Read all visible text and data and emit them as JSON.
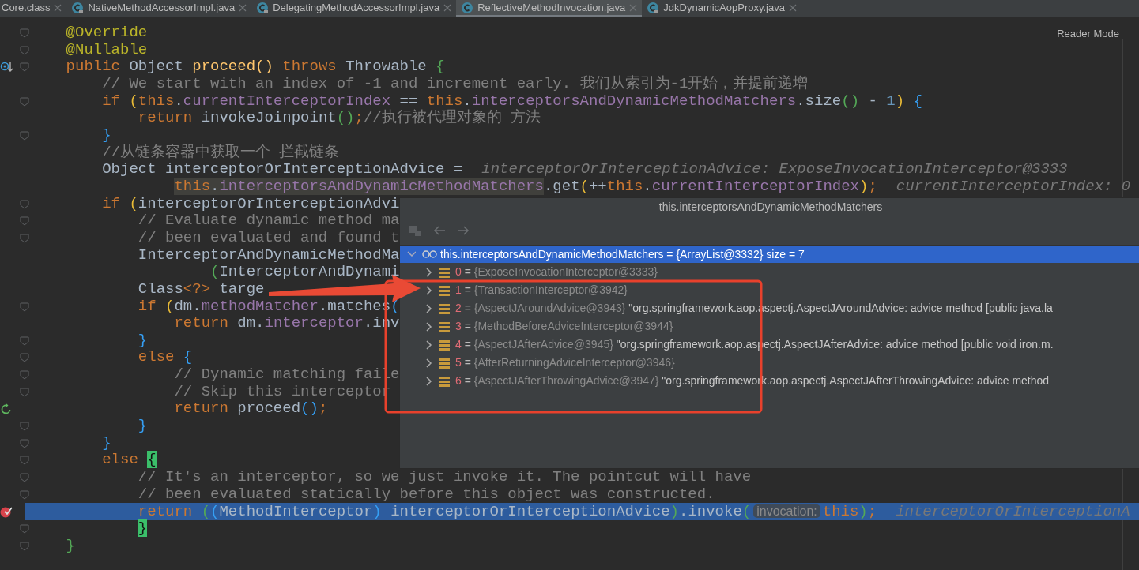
{
  "tabs": [
    {
      "label": "Core.class",
      "kind": "plain",
      "selected": false
    },
    {
      "label": "NativeMethodAccessorImpl.java",
      "kind": "class",
      "locked": true,
      "selected": false
    },
    {
      "label": "DelegatingMethodAccessorImpl.java",
      "kind": "class",
      "locked": true,
      "selected": false
    },
    {
      "label": "ReflectiveMethodInvocation.java",
      "kind": "class",
      "locked": false,
      "selected": true
    },
    {
      "label": "JdkDynamicAopProxy.java",
      "kind": "class",
      "locked": true,
      "selected": false
    }
  ],
  "reader_mode": "Reader Mode",
  "code_lines": [
    {
      "fold": true,
      "kind": "code",
      "tokens": [
        {
          "kind": "ann",
          "t": "    @Override"
        }
      ]
    },
    {
      "fold": true,
      "kind": "code",
      "tokens": [
        {
          "kind": "ann",
          "t": "    @Nullable"
        }
      ]
    },
    {
      "fold": true,
      "kind": "override",
      "tokens": [
        {
          "kind": "kw",
          "t": "    public"
        },
        {
          "kind": "p",
          "t": " Object "
        },
        {
          "kind": "fn",
          "t": "proceed()"
        },
        {
          "kind": "kw",
          "t": " throws"
        },
        {
          "kind": "p",
          "t": " Throwable "
        },
        {
          "kind": "b2",
          "t": "{"
        }
      ]
    },
    {
      "fold": false,
      "kind": "code",
      "tokens": [
        {
          "kind": "cm",
          "t": "        // We start with an index of -1 and increment early. 我们从索引为-1开始，并提前递增"
        }
      ]
    },
    {
      "fold": true,
      "kind": "code",
      "tokens": [
        {
          "kind": "kw",
          "t": "        if "
        },
        {
          "kind": "b1",
          "t": "("
        },
        {
          "kind": "kw",
          "t": "this"
        },
        {
          "kind": "p",
          "t": "."
        },
        {
          "kind": "fld",
          "t": "currentInterceptorIndex"
        },
        {
          "kind": "p",
          "t": " == "
        },
        {
          "kind": "kw",
          "t": "this"
        },
        {
          "kind": "p",
          "t": "."
        },
        {
          "kind": "fld",
          "t": "interceptorsAndDynamicMethodMatchers"
        },
        {
          "kind": "p",
          "t": ".size"
        },
        {
          "kind": "b2",
          "t": "()"
        },
        {
          "kind": "p",
          "t": " - "
        },
        {
          "kind": "num",
          "t": "1"
        },
        {
          "kind": "b1",
          "t": ")"
        },
        {
          "kind": "b3",
          "t": " {"
        }
      ]
    },
    {
      "fold": false,
      "kind": "code",
      "tokens": [
        {
          "kind": "kw",
          "t": "            return "
        },
        {
          "kind": "p",
          "t": "invokeJoinpoint"
        },
        {
          "kind": "b2",
          "t": "()"
        },
        {
          "kind": "kw",
          "t": ";"
        },
        {
          "kind": "cm",
          "t": "//执行被代理对象的 方法"
        }
      ]
    },
    {
      "fold": true,
      "kind": "code",
      "tokens": [
        {
          "kind": "b3",
          "t": "        }"
        }
      ]
    },
    {
      "fold": false,
      "kind": "code",
      "tokens": [
        {
          "kind": "cm",
          "t": "        //从链条容器中获取一个 拦截链条"
        }
      ]
    },
    {
      "fold": false,
      "kind": "code",
      "tokens": [
        {
          "kind": "p",
          "t": "        Object interceptorOrInterceptionAdvice ="
        },
        {
          "kind": "hint",
          "t": "interceptorOrInterceptionAdvice: ExposeInvocationInterceptor@3333"
        }
      ]
    },
    {
      "fold": false,
      "kind": "code",
      "tokens": [
        {
          "kind": "kw",
          "t": "                this",
          "hl": true
        },
        {
          "kind": "p",
          "t": ".",
          "hl": true
        },
        {
          "kind": "fld",
          "t": "interceptorsAndDynamicMethodMatchers",
          "hl": true
        },
        {
          "kind": "p",
          "t": ".get"
        },
        {
          "kind": "b1",
          "t": "("
        },
        {
          "kind": "p",
          "t": "++"
        },
        {
          "kind": "kw",
          "t": "this"
        },
        {
          "kind": "p",
          "t": "."
        },
        {
          "kind": "fld",
          "t": "currentInterceptorIndex"
        },
        {
          "kind": "b1",
          "t": ")"
        },
        {
          "kind": "kw",
          "t": ";"
        },
        {
          "kind": "hint",
          "t": "currentInterceptorIndex: 0"
        }
      ]
    },
    {
      "fold": true,
      "kind": "code",
      "tokens": [
        {
          "kind": "kw",
          "t": "        if "
        },
        {
          "kind": "b1",
          "t": "("
        },
        {
          "kind": "p",
          "t": "interceptorOrInterceptionAdvi"
        }
      ]
    },
    {
      "fold": true,
      "kind": "code",
      "tokens": [
        {
          "kind": "cm",
          "t": "            // Evaluate dynamic method ma"
        }
      ]
    },
    {
      "fold": true,
      "kind": "code",
      "tokens": [
        {
          "kind": "cm",
          "t": "            // been evaluated and found t"
        }
      ]
    },
    {
      "fold": false,
      "kind": "code",
      "tokens": [
        {
          "kind": "p",
          "t": "            InterceptorAndDynamicMethodMa"
        }
      ]
    },
    {
      "fold": false,
      "kind": "code",
      "tokens": [
        {
          "kind": "b2",
          "t": "                    ("
        },
        {
          "kind": "p",
          "t": "InterceptorAndDynami"
        }
      ]
    },
    {
      "fold": false,
      "kind": "code",
      "tokens": [
        {
          "kind": "p",
          "t": "            Class"
        },
        {
          "kind": "kw",
          "t": "<?>"
        },
        {
          "kind": "p",
          "t": " targe"
        }
      ]
    },
    {
      "fold": true,
      "kind": "code",
      "tokens": [
        {
          "kind": "kw",
          "t": "            if "
        },
        {
          "kind": "b1",
          "t": "("
        },
        {
          "kind": "p",
          "t": "dm."
        },
        {
          "kind": "fld",
          "t": "methodMatcher"
        },
        {
          "kind": "p",
          "t": ".matches"
        },
        {
          "kind": "b3",
          "t": "("
        }
      ]
    },
    {
      "fold": false,
      "kind": "code",
      "tokens": [
        {
          "kind": "kw",
          "t": "                return "
        },
        {
          "kind": "p",
          "t": "dm."
        },
        {
          "kind": "fld",
          "t": "interceptor"
        },
        {
          "kind": "p",
          "t": ".inv"
        }
      ]
    },
    {
      "fold": true,
      "kind": "code",
      "tokens": [
        {
          "kind": "b3",
          "t": "            }"
        }
      ]
    },
    {
      "fold": true,
      "kind": "code",
      "tokens": [
        {
          "kind": "kw",
          "t": "            else "
        },
        {
          "kind": "b3",
          "t": "{"
        }
      ]
    },
    {
      "fold": true,
      "kind": "code",
      "tokens": [
        {
          "kind": "cm",
          "t": "                // Dynamic matching faile"
        }
      ]
    },
    {
      "fold": true,
      "kind": "code",
      "tokens": [
        {
          "kind": "cm",
          "t": "                // Skip this interceptor"
        }
      ]
    },
    {
      "fold": false,
      "kind": "rerun",
      "tokens": [
        {
          "kind": "kw",
          "t": "                return "
        },
        {
          "kind": "p",
          "t": "proceed"
        },
        {
          "kind": "b3",
          "t": "()"
        },
        {
          "kind": "kw",
          "t": ";"
        }
      ]
    },
    {
      "fold": true,
      "kind": "code",
      "tokens": [
        {
          "kind": "b3",
          "t": "            }"
        }
      ]
    },
    {
      "fold": true,
      "kind": "code",
      "tokens": [
        {
          "kind": "b3",
          "t": "        }"
        }
      ]
    },
    {
      "fold": true,
      "kind": "code",
      "tokens": [
        {
          "kind": "kw",
          "t": "        else "
        },
        {
          "kind": "match",
          "t": "{"
        }
      ]
    },
    {
      "fold": true,
      "kind": "code",
      "tokens": [
        {
          "kind": "cm",
          "t": "            // It's an interceptor, so we just invoke it. The pointcut will have"
        }
      ]
    },
    {
      "fold": true,
      "kind": "code",
      "tokens": [
        {
          "kind": "cm",
          "t": "            // been evaluated statically before this object was constructed."
        }
      ]
    },
    {
      "fold": false,
      "kind": "breakpoint",
      "current": true,
      "tokens": [
        {
          "kind": "kw",
          "t": "            return "
        },
        {
          "kind": "b2",
          "t": "("
        },
        {
          "kind": "b3",
          "t": "("
        },
        {
          "kind": "p",
          "t": "MethodInterceptor"
        },
        {
          "kind": "b3",
          "t": ")"
        },
        {
          "kind": "p",
          "t": " interceptorOrInterceptionAdvice"
        },
        {
          "kind": "b2",
          "t": ")"
        },
        {
          "kind": "p",
          "t": ".invoke"
        },
        {
          "kind": "b2",
          "t": "("
        },
        {
          "kind": "param",
          "t": "invocation:"
        },
        {
          "kind": "kw",
          "t": "this"
        },
        {
          "kind": "b2",
          "t": ")"
        },
        {
          "kind": "kw",
          "t": ";"
        },
        {
          "kind": "hint",
          "t": "interceptorOrInterceptionA"
        }
      ]
    },
    {
      "fold": true,
      "kind": "code",
      "tokens": [
        {
          "kind": "match",
          "t": "            }"
        }
      ]
    },
    {
      "fold": true,
      "kind": "code",
      "tokens": [
        {
          "kind": "b2",
          "t": "    }"
        }
      ]
    }
  ],
  "popup": {
    "title": "this.interceptorsAndDynamicMethodMatchers",
    "root": {
      "label": "this.interceptorsAndDynamicMethodMatchers = {ArrayList@3332}  size = 7",
      "selected": true,
      "expanded": true
    },
    "items": [
      {
        "index": "0",
        "sep": "=",
        "ref": "{ExposeInvocationInterceptor@3333}",
        "expanded": false
      },
      {
        "index": "1",
        "sep": "=",
        "ref": "{TransactionInterceptor@3942}",
        "expanded": false
      },
      {
        "index": "2",
        "sep": "=",
        "ref": "{AspectJAroundAdvice@3943}",
        "desc": "\"org.springframework.aop.aspectj.AspectJAroundAdvice: advice method [public java.la",
        "expanded": false
      },
      {
        "index": "3",
        "sep": "=",
        "ref": "{MethodBeforeAdviceInterceptor@3944}",
        "expanded": false
      },
      {
        "index": "4",
        "sep": "=",
        "ref": "{AspectJAfterAdvice@3945}",
        "desc": "\"org.springframework.aop.aspectj.AspectJAfterAdvice: advice method [public void iron.m.",
        "expanded": false
      },
      {
        "index": "5",
        "sep": "=",
        "ref": "{AfterReturningAdviceInterceptor@3946}",
        "expanded": false
      },
      {
        "index": "6",
        "sep": "=",
        "ref": "{AspectJAfterThrowingAdvice@3947}",
        "desc": "\"org.springframework.aop.aspectj.AspectJAfterThrowingAdvice: advice method",
        "expanded": false
      }
    ]
  }
}
